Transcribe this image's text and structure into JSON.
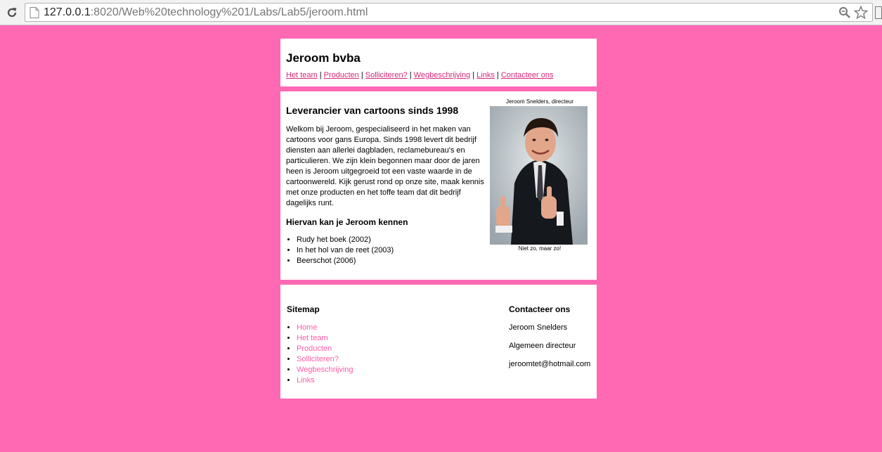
{
  "browser": {
    "url_host": "127.0.0.1",
    "url_rest": ":8020/Web%20technology%201/Labs/Lab5/jeroom.html"
  },
  "header": {
    "title": "Jeroom bvba",
    "nav": [
      "Het team",
      "Producten",
      "Solliciteren?",
      "Wegbeschrijving",
      "Links",
      "Contacteer ons"
    ]
  },
  "content": {
    "heading": "Leverancier van cartoons sinds 1998",
    "intro": "Welkom bij Jeroom, gespecialiseerd in het maken van cartoons voor gans Europa. Sinds 1998 levert dit bedrijf diensten aan allerlei dagbladen, reclamebureau's en particulieren. We zijn klein begonnen maar door de jaren heen is Jeroom uitgegroeid tot een vaste waarde in de cartoonwereld. Kijk gerust rond op onze site, maak kennis met onze producten en het toffe team dat dit bedrijf dagelijks runt.",
    "subheading": "Hiervan kan je Jeroom kennen",
    "known_for": [
      "Rudy het boek (2002)",
      "In het hol van de reet (2003)",
      "Beerschot (2006)"
    ],
    "photo_caption_top": "Jeroom Snelders, directeur",
    "photo_caption_bottom": "Niet zo, maar zo!"
  },
  "footer": {
    "sitemap_title": "Sitemap",
    "sitemap": [
      "Home",
      "Het team",
      "Producten",
      "Solliciteren?",
      "Wegbeschrijving",
      "Links"
    ],
    "contact_title": "Contacteer ons",
    "contact_name": "Jeroom Snelders",
    "contact_role": "Algemeen directeur",
    "contact_email": "jeroomtet@hotmail.com"
  },
  "colors": {
    "background": "#ff69b4",
    "link": "#d6287a",
    "sitemap_link": "#ff5ca8"
  },
  "icons": [
    "reload-icon",
    "page-icon",
    "zoom-icon",
    "star-icon"
  ]
}
